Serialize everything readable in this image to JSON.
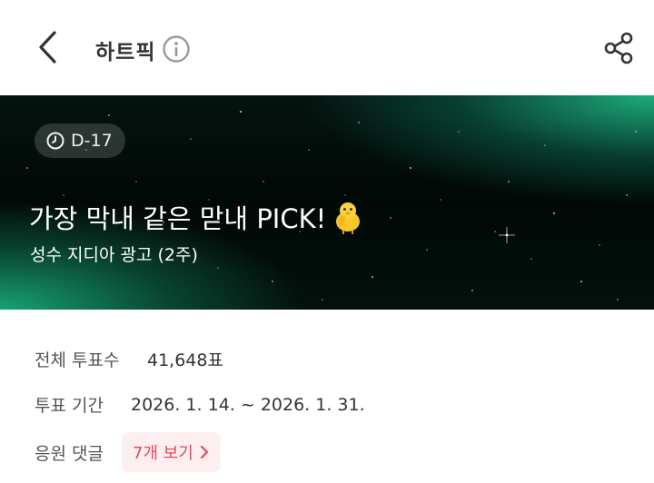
{
  "header": {
    "title": "하트픽"
  },
  "banner": {
    "dday": "D-17",
    "title": "가장 막내 같은 맏내 PICK!",
    "subtitle": "성수 지디아 광고 (2주)"
  },
  "info": {
    "total_votes_label": "전체 투표수",
    "total_votes_value": "41,648표",
    "period_label": "투표 기간",
    "period_value": "2026. 1. 14. ~ 2026. 1. 31.",
    "comments_label": "응원 댓글",
    "comments_button": "7개 보기"
  },
  "colors": {
    "accent": "#e04a5e",
    "accent_bg": "#fdeef0",
    "banner_green": "#18aa78"
  },
  "icons": [
    "back-arrow-icon",
    "info-icon",
    "share-icon",
    "clock-icon",
    "chick-emoji-icon",
    "chevron-right-icon"
  ]
}
